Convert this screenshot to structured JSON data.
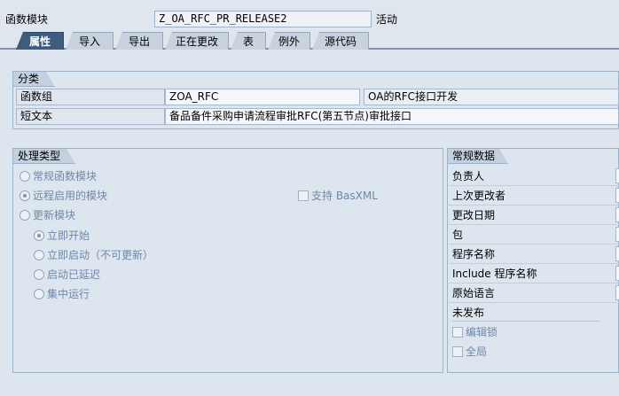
{
  "header": {
    "label": "函数模块",
    "module_name": "Z_OA_RFC_PR_RELEASE2",
    "status": "活动"
  },
  "tabs": [
    "属性",
    "导入",
    "导出",
    "正在更改",
    "表",
    "例外",
    "源代码"
  ],
  "classification": {
    "title": "分类",
    "function_group_label": "函数组",
    "function_group_value": "ZOA_RFC",
    "function_group_desc": "OA的RFC接口开发",
    "short_text_label": "短文本",
    "short_text_value": "备品备件采购申请流程审批RFC(第五节点)审批接口"
  },
  "processing": {
    "title": "处理类型",
    "options": {
      "normal": "常规函数模块",
      "remote": "远程启用的模块",
      "update": "更新模块",
      "immediate": "立即开始",
      "immediate_no_update": "立即启动（不可更新）",
      "delayed": "启动已延迟",
      "collective": "集中运行"
    },
    "basxml_label": "支持 BasXML"
  },
  "general": {
    "title": "常规数据",
    "rows": [
      "负责人",
      "上次更改者",
      "更改日期",
      "包",
      "程序名称",
      "Include 程序名称",
      "原始语言"
    ],
    "unreleased": "未发布",
    "edit_lock": "编辑锁",
    "global": "全局"
  }
}
